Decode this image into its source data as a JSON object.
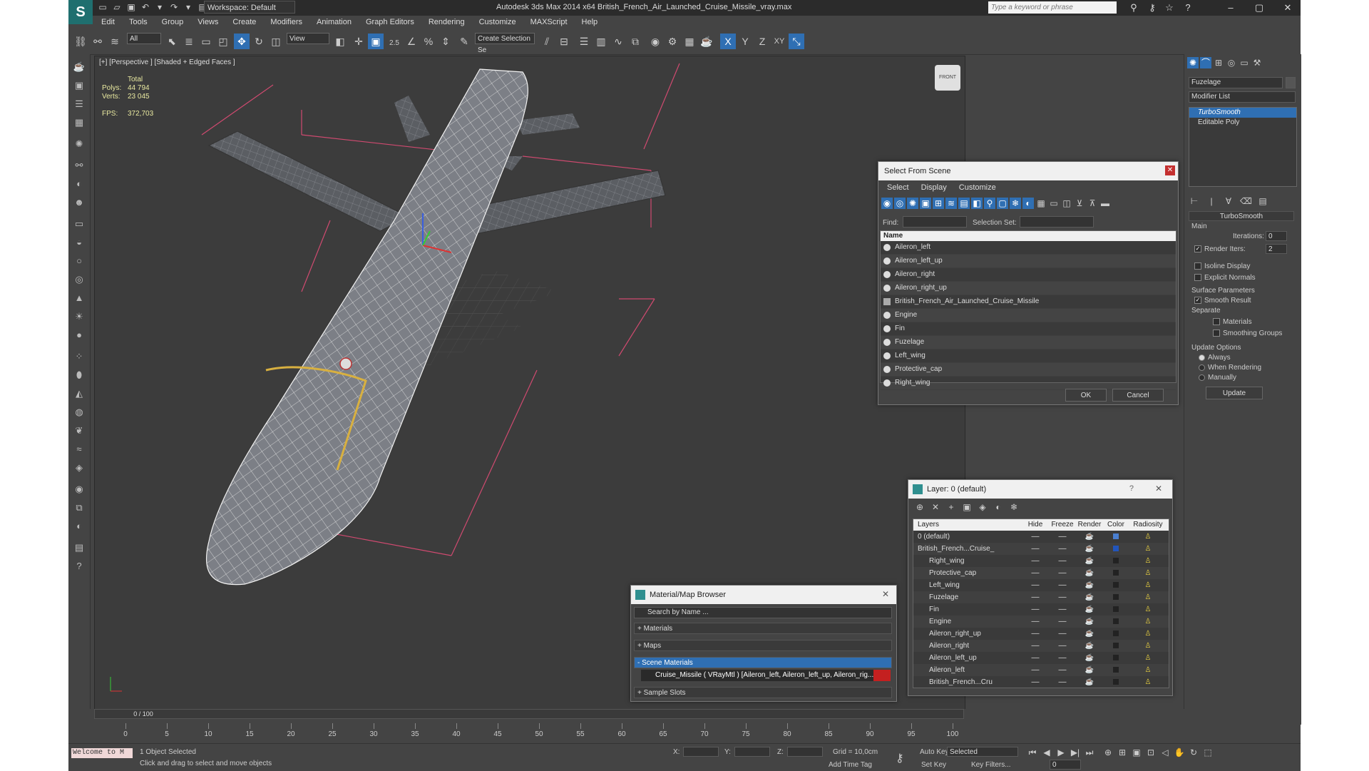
{
  "window": {
    "title": "Autodesk 3ds Max  2014 x64    British_French_Air_Launched_Cruise_Missile_vray.max",
    "workspace": "Workspace: Default",
    "search_placeholder": "Type a keyword or phrase"
  },
  "menu": [
    "Edit",
    "Tools",
    "Group",
    "Views",
    "Create",
    "Modifiers",
    "Animation",
    "Graph Editors",
    "Rendering",
    "Customize",
    "MAXScript",
    "Help"
  ],
  "toolbar": {
    "filter": "All",
    "ref_coord": "View",
    "selection_set": "Create Selection Se",
    "axes": [
      "X",
      "Y",
      "Z",
      "XY"
    ],
    "snap_label": "2.5"
  },
  "viewport": {
    "label": "[+] [Perspective ] [Shaded + Edged Faces ]",
    "stats": {
      "header": "Total",
      "polys_label": "Polys:",
      "polys": "44 794",
      "verts_label": "Verts:",
      "verts": "23 045",
      "fps_label": "FPS:",
      "fps": "372,703"
    },
    "viewcube": "FRONT"
  },
  "command_panel": {
    "object_name": "Fuzelage",
    "modifier_list": "Modifier List",
    "stack": [
      "TurboSmooth",
      "Editable Poly"
    ],
    "turbosmooth": {
      "title": "TurboSmooth",
      "main": "Main",
      "iterations_label": "Iterations:",
      "iterations": "0",
      "render_iters_label": "Render Iters:",
      "render_iters": "2",
      "isoline": "Isoline Display",
      "explicit": "Explicit Normals",
      "surface": "Surface Parameters",
      "smooth_result": "Smooth Result",
      "separate": "Separate",
      "materials": "Materials",
      "smoothing_groups": "Smoothing Groups",
      "update_options": "Update Options",
      "always": "Always",
      "when_rendering": "When Rendering",
      "manually": "Manually",
      "update": "Update"
    }
  },
  "select_from_scene": {
    "title": "Select From Scene",
    "menu": [
      "Select",
      "Display",
      "Customize"
    ],
    "find_label": "Find:",
    "selection_set_label": "Selection Set:",
    "column": "Name",
    "items": [
      "Aileron_left",
      "Aileron_left_up",
      "Aileron_right",
      "Aileron_right_up",
      "British_French_Air_Launched_Cruise_Missile",
      "Engine",
      "Fin",
      "Fuzelage",
      "Left_wing",
      "Protective_cap",
      "Right_wing"
    ],
    "ok": "OK",
    "cancel": "Cancel"
  },
  "layer_dialog": {
    "title": "Layer: 0 (default)",
    "help": "?",
    "columns": [
      "Layers",
      "Hide",
      "Freeze",
      "Render",
      "Color",
      "Radiosity"
    ],
    "rows": [
      {
        "name": "0 (default)",
        "color": "#4a7fd0"
      },
      {
        "name": "British_French...Cruise_",
        "color": "#2255bb"
      },
      {
        "name": "Right_wing",
        "color": "#222222"
      },
      {
        "name": "Protective_cap",
        "color": "#222222"
      },
      {
        "name": "Left_wing",
        "color": "#222222"
      },
      {
        "name": "Fuzelage",
        "color": "#222222"
      },
      {
        "name": "Fin",
        "color": "#222222"
      },
      {
        "name": "Engine",
        "color": "#222222"
      },
      {
        "name": "Aileron_right_up",
        "color": "#222222"
      },
      {
        "name": "Aileron_right",
        "color": "#222222"
      },
      {
        "name": "Aileron_left_up",
        "color": "#222222"
      },
      {
        "name": "Aileron_left",
        "color": "#222222"
      },
      {
        "name": "British_French...Cru",
        "color": "#222222"
      }
    ]
  },
  "material_browser": {
    "title": "Material/Map Browser",
    "search": "Search by Name ...",
    "sections": [
      "+ Materials",
      "+ Maps",
      "- Scene Materials"
    ],
    "scene_material": "Cruise_Missile ( VRayMtl ) [Aileron_left, Aileron_left_up, Aileron_rig...",
    "sample_slots": "+ Sample Slots"
  },
  "timeline": {
    "frame": "0 / 100",
    "ticks": [
      "0",
      "5",
      "10",
      "15",
      "20",
      "25",
      "30",
      "35",
      "40",
      "45",
      "50",
      "55",
      "60",
      "65",
      "70",
      "75",
      "80",
      "85",
      "90",
      "95",
      "100"
    ]
  },
  "status": {
    "maxscript": "Welcome to M",
    "selected": "1 Object Selected",
    "prompt": "Click and drag to select and move objects",
    "x_label": "X:",
    "y_label": "Y:",
    "z_label": "Z:",
    "grid": "Grid = 10,0cm",
    "auto_key": "Auto Key",
    "selected_dropdown": "Selected",
    "set_key": "Set Key",
    "key_filters": "Key Filters...",
    "add_time_tag": "Add Time Tag",
    "frame_field": "0"
  },
  "colors": {
    "accent": "#2f6fb3",
    "ui_bg": "#444444",
    "viewport_bg": "#3c3c3c",
    "stats_text": "#e9e9a0"
  }
}
